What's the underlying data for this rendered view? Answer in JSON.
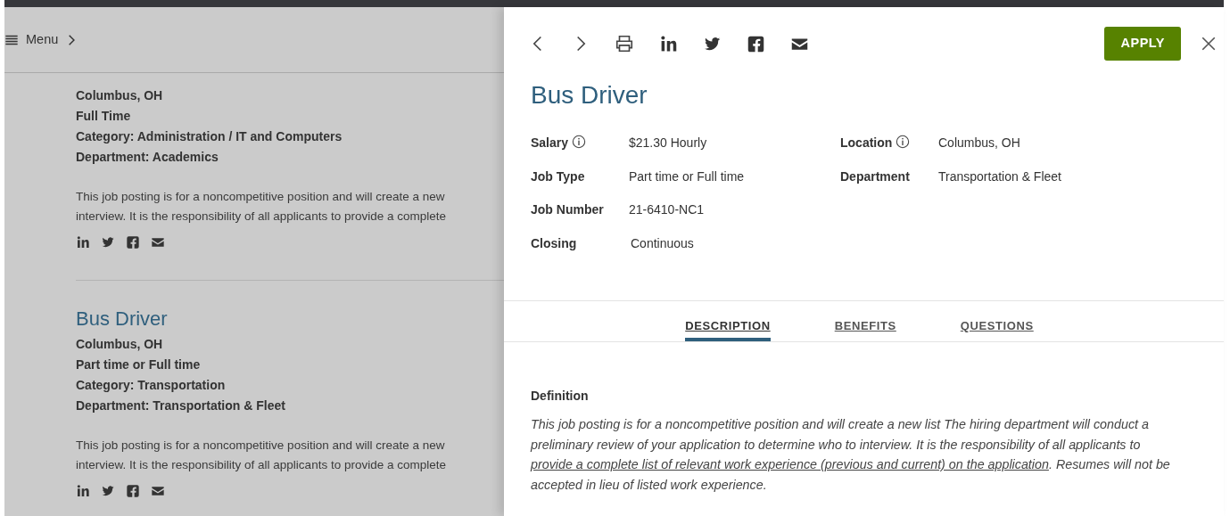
{
  "left_panel": {
    "menu": {
      "label": "Menu"
    },
    "postings": [
      {
        "lines": [
          "Columbus, OH",
          "Full Time",
          "Category: Administration / IT and Computers",
          "Department: Academics"
        ],
        "summary": [
          "This job posting is for a noncompetitive position and will create a new",
          "interview. It is the responsibility of all applicants to provide a complete"
        ]
      },
      {
        "title": "Bus Driver",
        "lines": [
          "Columbus, OH",
          "Part time or Full time",
          "Category: Transportation",
          "Department: Transportation & Fleet"
        ],
        "summary": [
          "This job posting is for a noncompetitive position and will create a new",
          "interview. It is the responsibility of all applicants to provide a complete"
        ]
      }
    ]
  },
  "detail_panel": {
    "apply_button": "APPLY",
    "title": "Bus Driver",
    "details": [
      [
        {
          "label": "Salary",
          "info": true,
          "value": "$21.30 Hourly"
        },
        {
          "label": "Job Type",
          "info": false,
          "value": "Part time or Full time"
        },
        {
          "label": "Job Number",
          "info": false,
          "value": "21-6410-NC1"
        },
        {
          "label": "Closing",
          "info": false,
          "value": "Continuous"
        }
      ],
      [
        {
          "label": "Location",
          "info": true,
          "value": "Columbus, OH"
        },
        {
          "label": "Department",
          "info": false,
          "value": "Transportation & Fleet"
        }
      ]
    ],
    "tabs": [
      {
        "label": "DESCRIPTION",
        "selected": true
      },
      {
        "label": "BENEFITS",
        "selected": false
      },
      {
        "label": "QUESTIONS",
        "selected": false
      }
    ],
    "section_heading": "Definition",
    "description": {
      "text_before": "This job posting is for a noncompetitive position and will create a new list The hiring department will conduct a preliminary review of your application to determine who to interview. It is the responsibility of all applicants to ",
      "link": "provide a complete list of relevant work experience (previous and current) on the application",
      "text_after": ". Resumes will not be accepted in lieu of listed work experience."
    }
  }
}
